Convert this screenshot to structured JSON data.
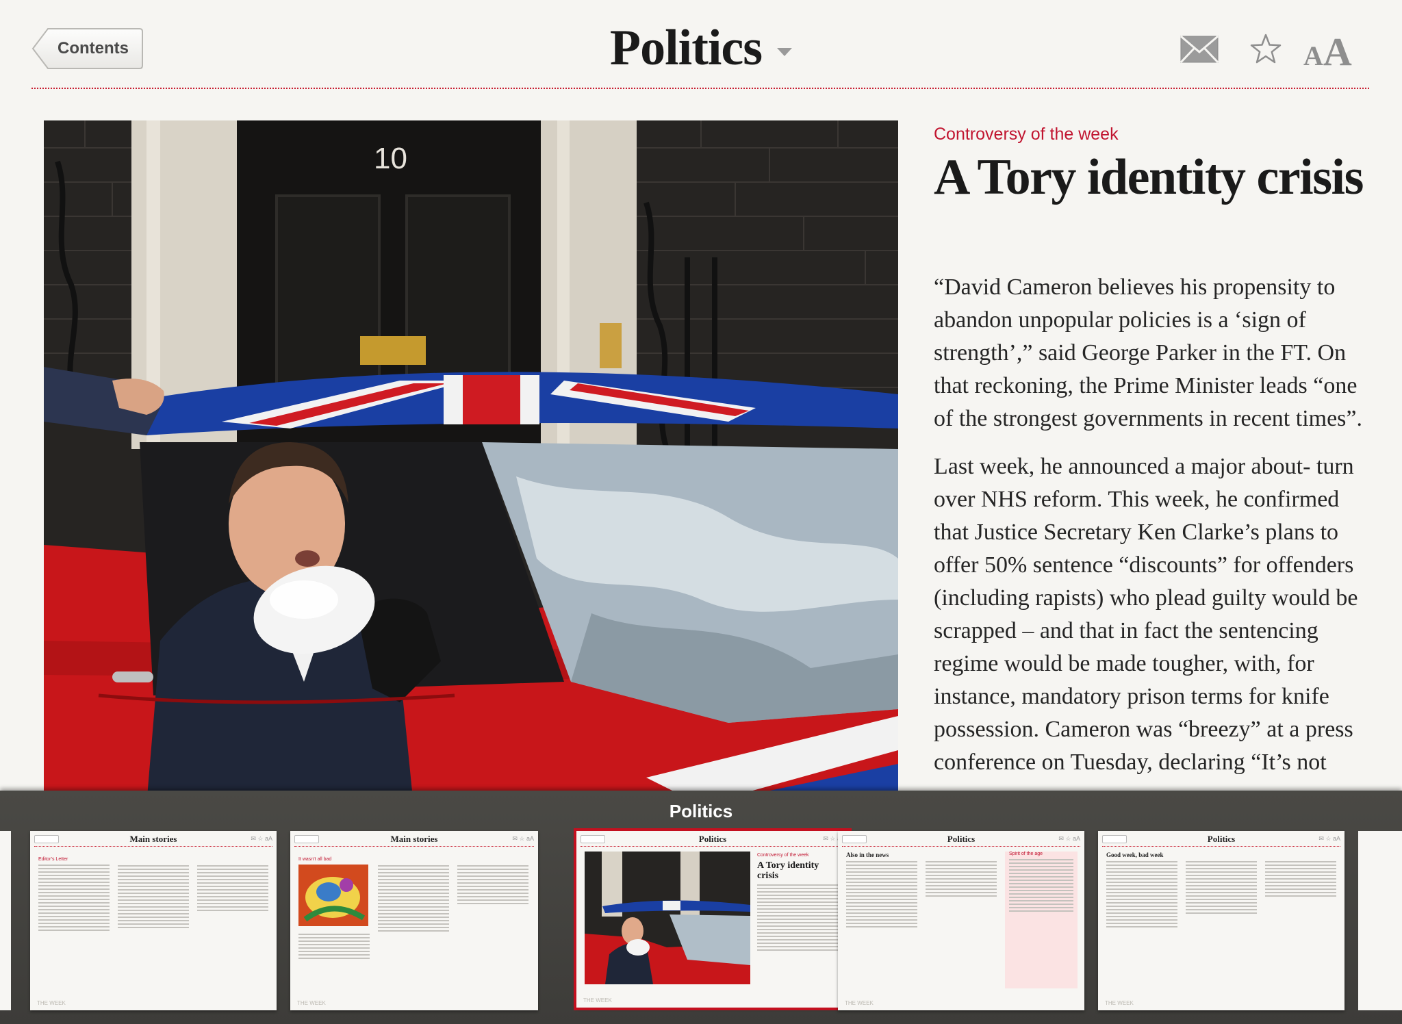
{
  "header": {
    "back_label": "Contents",
    "title": "Politics",
    "icons": [
      "mail-icon",
      "star-icon",
      "font-size-icon"
    ],
    "font_small": "A",
    "font_big": "A"
  },
  "article": {
    "kicker": "Controversy of the week",
    "headline": "A Tory identity crisis",
    "paragraph_1": "“David Cameron believes his propensity to abandon unpopular policies is a ‘sign of strength’,” said George Parker in the FT. On that reckoning, the Prime Minister leads “one of the strongest governments in recent times”.",
    "paragraph_2": "Last week, he announced a major about- turn over NHS reform. This week, he confirmed that Justice Secretary Ken Clarke’s plans to offer 50% sentence “discounts” for offenders (including rapists) who plead guilty would be scrapped – and that in fact the sentencing regime would be made tougher, with, for instance, mandatory prison terms for knife possession. Cameron was “breezy” at a press conference on Tuesday, declaring “It’s not",
    "photo_door_number": "10"
  },
  "strip": {
    "title": "Politics",
    "pages": [
      {
        "title": "Main stories",
        "kicker": "Editor’s Letter"
      },
      {
        "title": "Main stories",
        "kicker": "It wasn’t all bad"
      },
      {
        "title": "Politics",
        "kicker": "Controversy of the week",
        "headline": "A Tory identity crisis",
        "current": true
      },
      {
        "title": "Politics",
        "kicker": "Also in the news",
        "side_kicker": "Spirit of the age"
      },
      {
        "title": "Politics",
        "kicker": "Good week, bad week"
      }
    ],
    "footer_mark": "THE WEEK"
  },
  "colors": {
    "accent_red": "#c11530",
    "strip_bg": "#444340",
    "page_bg": "#f6f5f2"
  }
}
